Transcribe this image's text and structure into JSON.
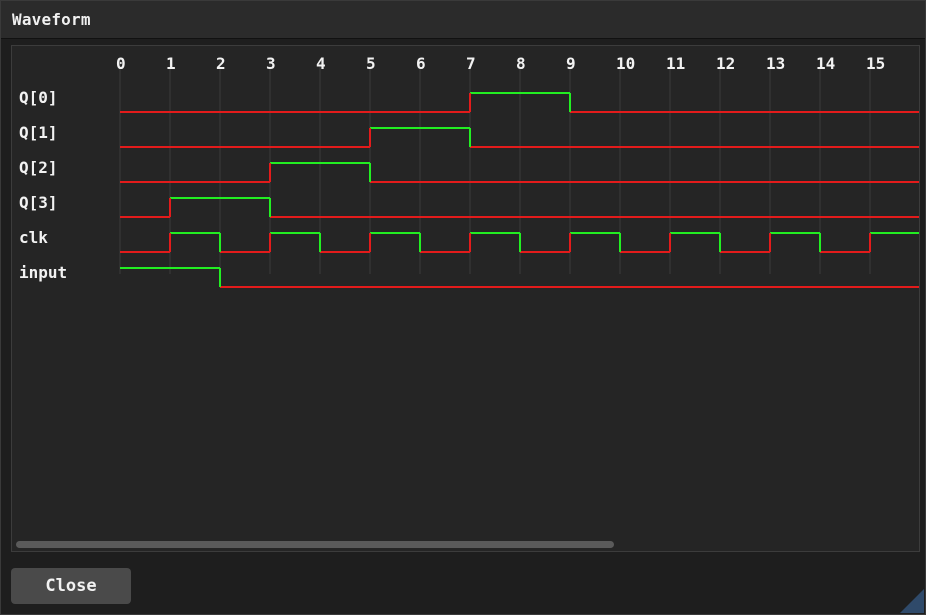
{
  "window": {
    "title": "Waveform"
  },
  "waveform": {
    "ticks": [
      "0",
      "1",
      "2",
      "3",
      "4",
      "5",
      "6",
      "7",
      "8",
      "9",
      "10",
      "11",
      "12",
      "13",
      "14",
      "15"
    ],
    "colors": {
      "high": "#22ee22",
      "low": "#e31b1b",
      "grid": "#3a3a3a"
    },
    "signals": [
      {
        "name": "Q[0]",
        "values": [
          0,
          0,
          0,
          0,
          0,
          0,
          0,
          1,
          1,
          0,
          0,
          0,
          0,
          0,
          0,
          0
        ]
      },
      {
        "name": "Q[1]",
        "values": [
          0,
          0,
          0,
          0,
          0,
          1,
          1,
          0,
          0,
          0,
          0,
          0,
          0,
          0,
          0,
          0
        ]
      },
      {
        "name": "Q[2]",
        "values": [
          0,
          0,
          0,
          1,
          1,
          0,
          0,
          0,
          0,
          0,
          0,
          0,
          0,
          0,
          0,
          0
        ]
      },
      {
        "name": "Q[3]",
        "values": [
          0,
          1,
          1,
          0,
          0,
          0,
          0,
          0,
          0,
          0,
          0,
          0,
          0,
          0,
          0,
          0
        ]
      },
      {
        "name": "clk",
        "values": [
          0,
          1,
          0,
          1,
          0,
          1,
          0,
          1,
          0,
          1,
          0,
          1,
          0,
          1,
          0,
          1
        ]
      },
      {
        "name": "input",
        "values": [
          1,
          1,
          0,
          0,
          0,
          0,
          0,
          0,
          0,
          0,
          0,
          0,
          0,
          0,
          0,
          0
        ]
      }
    ]
  },
  "footer": {
    "close_label": "Close"
  }
}
